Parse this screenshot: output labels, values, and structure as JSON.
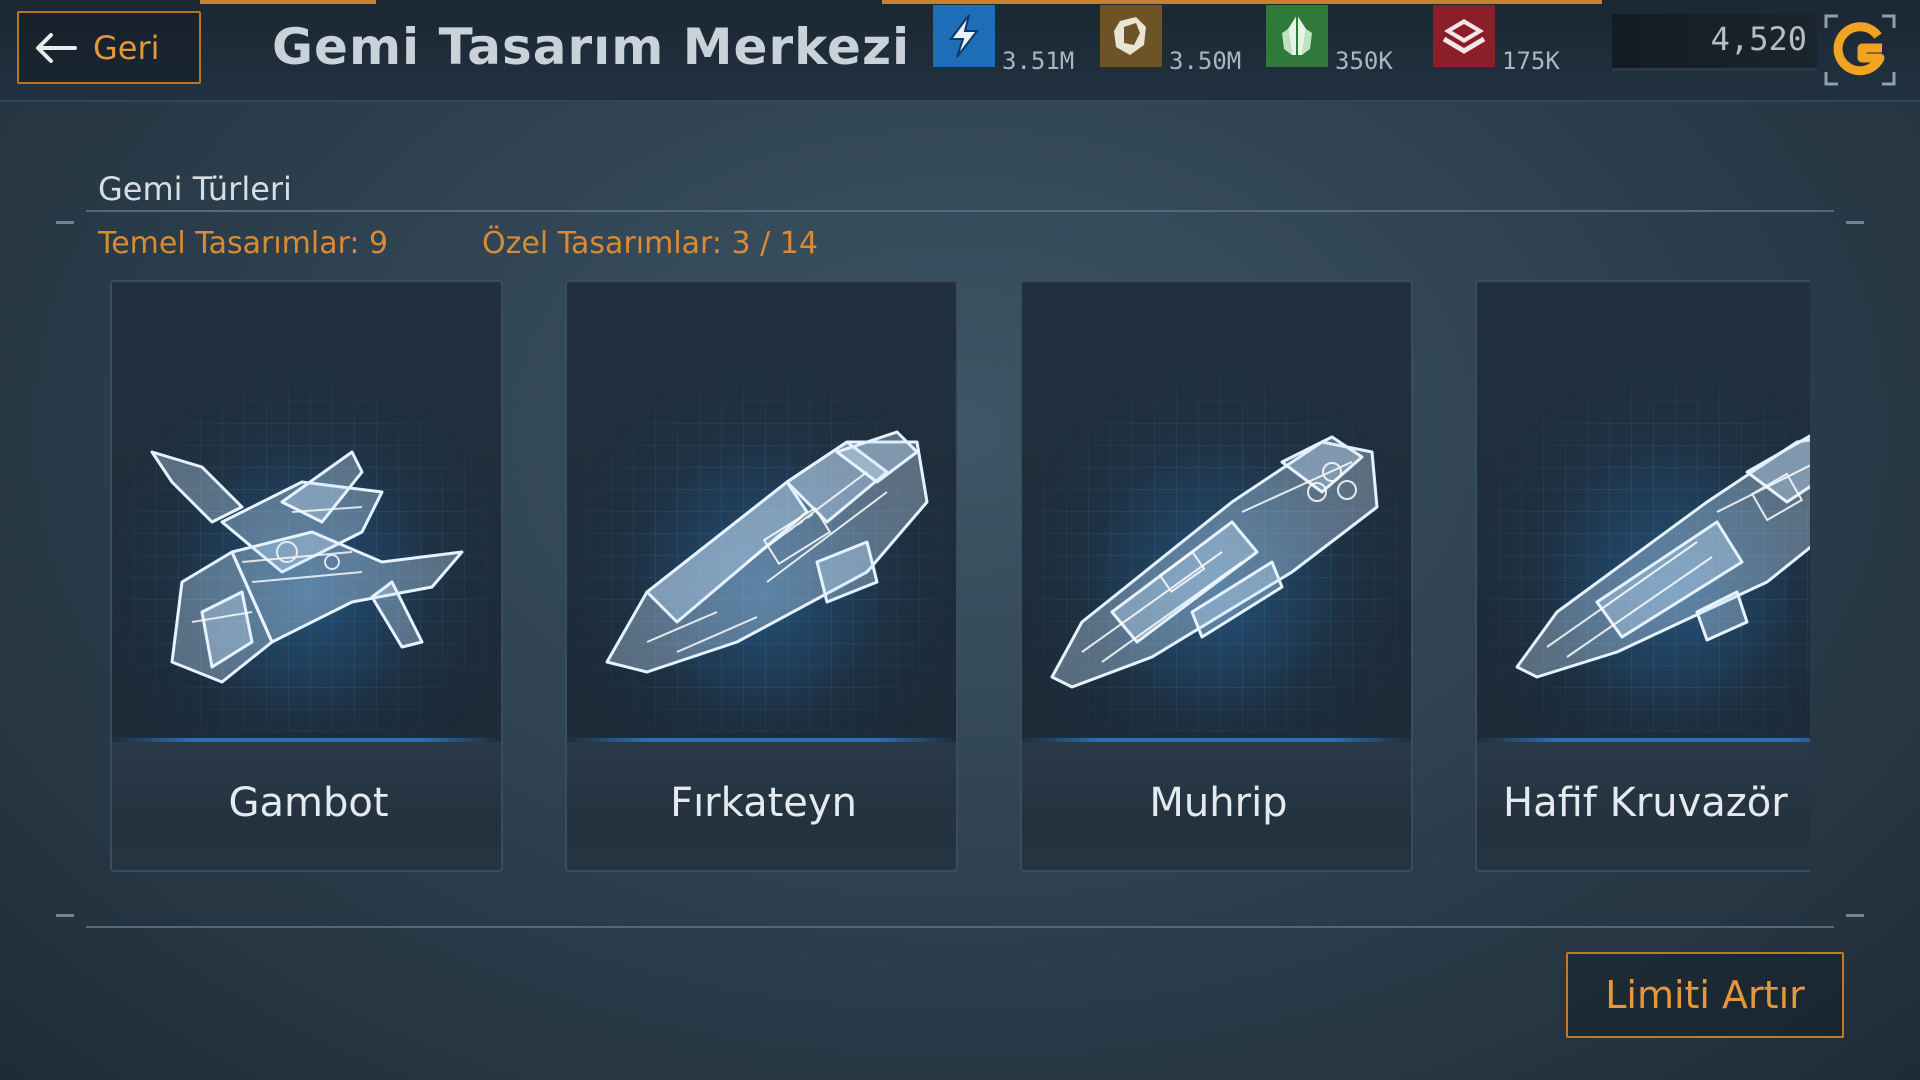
{
  "header": {
    "back_label": "Geri",
    "title": "Gemi Tasarım Merkezi",
    "resources": [
      {
        "name": "energy-icon",
        "value": "3.51M",
        "color": "#1e6db7"
      },
      {
        "name": "ore-icon",
        "value": "3.50M",
        "color": "#7a5a2a"
      },
      {
        "name": "crystal-icon",
        "value": "350K",
        "color": "#2f7a3a"
      },
      {
        "name": "material-icon",
        "value": "175K",
        "color": "#8a1f2a"
      }
    ],
    "currency_value": "4,520",
    "currency_icon": "premium-currency-icon"
  },
  "panel": {
    "section_title": "Gemi Türleri",
    "basic_designs": "Temel Tasarımlar: 9",
    "custom_designs": "Özel Tasarımlar:  3 / 14",
    "cards": [
      {
        "label": "Gambot",
        "icon": "gunboat-blueprint-icon"
      },
      {
        "label": "Fırkateyn",
        "icon": "frigate-blueprint-icon"
      },
      {
        "label": "Muhrip",
        "icon": "destroyer-blueprint-icon"
      },
      {
        "label": "Hafif Kruvazör",
        "icon": "light-cruiser-blueprint-icon"
      }
    ]
  },
  "footer": {
    "increase_limit_label": "Limiti Artır"
  },
  "colors": {
    "accent_orange": "#e3963a",
    "background": "#2f4352",
    "blueprint_blue": "#2b6fb0"
  }
}
